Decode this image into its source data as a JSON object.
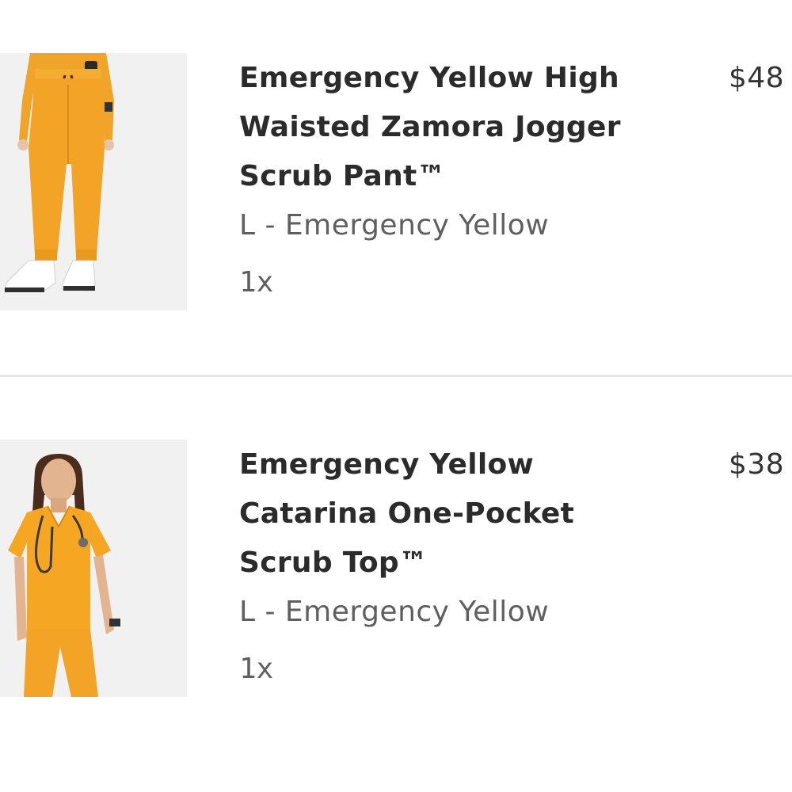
{
  "cart": {
    "items": [
      {
        "name_lines": [
          "Emergency Yellow High",
          "Waisted Zamora Jogger",
          "Scrub Pant™"
        ],
        "variant": "L - Emergency Yellow",
        "quantity": "1x",
        "price": "$48",
        "image": "product-photo-jogger-pant"
      },
      {
        "name_lines": [
          "Emergency Yellow",
          "Catarina One-Pocket",
          "Scrub Top™"
        ],
        "variant": "L - Emergency Yellow",
        "quantity": "1x",
        "price": "$38",
        "image": "product-photo-scrub-top"
      }
    ]
  },
  "colors": {
    "product_yellow": "#f5a623",
    "text_dark": "#2b2b2b",
    "text_muted": "#5f5f5f",
    "divider": "#e6e6e6"
  }
}
